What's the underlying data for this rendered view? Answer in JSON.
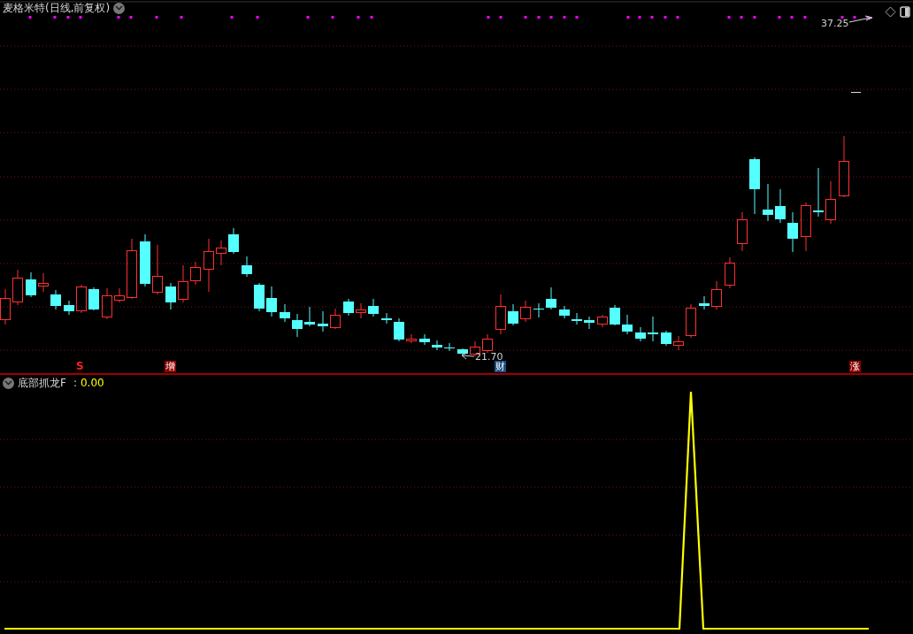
{
  "main_panel": {
    "title": "麦格米特",
    "period": "(日线,前复权)",
    "high_label": "37.25",
    "low_label": "21.70",
    "markers": [
      {
        "text": "S",
        "kind": "arrow",
        "color": "#ff2020"
      },
      {
        "text": "增",
        "kind": "tag",
        "color": "#8b0000"
      },
      {
        "text": "财",
        "kind": "tag",
        "color": "#1c4f80"
      },
      {
        "text": "涨",
        "kind": "tag",
        "color": "#8b0000"
      }
    ]
  },
  "indicator_panel": {
    "name": "底部抓龙F",
    "separator": ":",
    "value": "0.00"
  }
}
